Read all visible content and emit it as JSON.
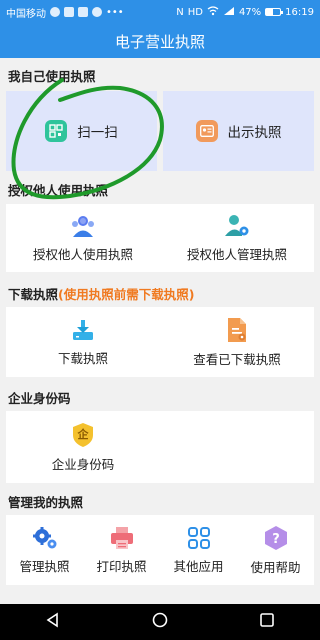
{
  "status": {
    "carrier": "中国移动",
    "battery": "47%",
    "time": "16:19",
    "network": "HD",
    "battery_level": 0.47
  },
  "header": {
    "title": "电子营业执照"
  },
  "sections": {
    "self": {
      "title": "我自己使用执照",
      "scan_label": "扫一扫",
      "show_label": "出示执照"
    },
    "authorize": {
      "title": "授权他人使用执照",
      "use_label": "授权他人使用执照",
      "manage_label": "授权他人管理执照"
    },
    "download": {
      "title": "下载执照",
      "warning": "(使用执照前需下载执照)",
      "download_label": "下载执照",
      "view_label": "查看已下载执照"
    },
    "enterprise": {
      "title": "企业身份码",
      "code_label": "企业身份码",
      "badge_char": "企"
    },
    "manage": {
      "title": "管理我的执照",
      "items": [
        "管理执照",
        "打印执照",
        "其他应用",
        "使用帮助"
      ]
    }
  },
  "colors": {
    "primary": "#2e90e7",
    "tile_bg": "#dfe5fb",
    "warn": "#f07a21",
    "green_mark": "#1f9a2b"
  }
}
